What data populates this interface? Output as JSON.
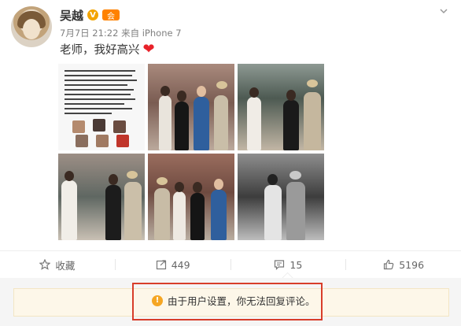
{
  "post": {
    "username": "吴越",
    "verified_mark": "V",
    "member_mark": "会",
    "meta": "7月7日 21:22 来自 iPhone 7",
    "text": "老师，我好高兴",
    "emoji_name": "heart-icon"
  },
  "actions": {
    "favorite_label": "收藏",
    "forward_count": "449",
    "comment_count": "15",
    "like_count": "5196"
  },
  "notice": {
    "text": "由于用户设置，你无法回复评论。",
    "icon": "!"
  },
  "colors": {
    "verified": "#f3a400",
    "heart": "#e8222a",
    "highlight_border": "#d83d2a",
    "notice_bg": "#fdf7e9"
  }
}
